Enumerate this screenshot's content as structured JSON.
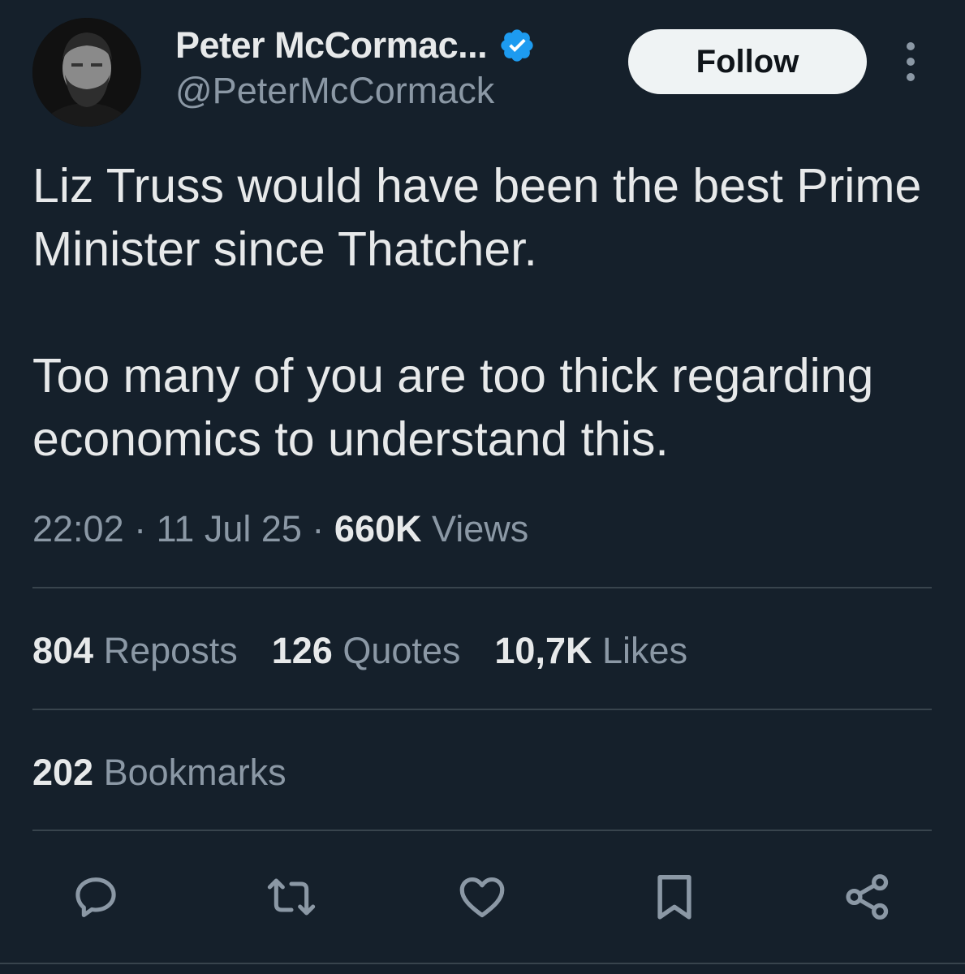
{
  "author": {
    "display_name": "Peter McCormac...",
    "handle": "@PeterMcCormack",
    "verified_icon": "verified-badge-icon"
  },
  "follow_label": "Follow",
  "tweet": {
    "paragraphs": [
      "Liz Truss would have been the best Prime Minister since Thatcher.",
      "Too many of you are too thick regarding economics to understand this."
    ]
  },
  "meta": {
    "time": "22:02",
    "date": "11 Jul 25",
    "views_count": "660K",
    "views_label": "Views",
    "separator": " · "
  },
  "stats": {
    "reposts": {
      "count": "804",
      "label": "Reposts"
    },
    "quotes": {
      "count": "126",
      "label": "Quotes"
    },
    "likes": {
      "count": "10,7K",
      "label": "Likes"
    },
    "bookmarks": {
      "count": "202",
      "label": "Bookmarks"
    }
  },
  "actions": [
    "reply-icon",
    "repost-icon",
    "like-icon",
    "bookmark-icon",
    "share-icon"
  ],
  "colors": {
    "background": "#15202b",
    "text": "#e7e9ea",
    "secondary": "#8b98a5",
    "divider": "#38444d",
    "verified": "#1d9bf0"
  }
}
